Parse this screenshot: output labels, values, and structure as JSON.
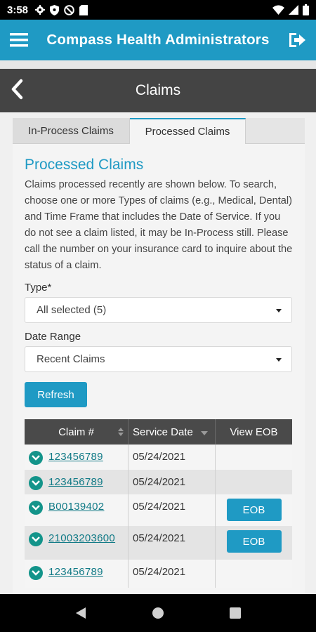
{
  "status_bar": {
    "time": "3:58",
    "icons": [
      "gear-icon",
      "shield-icon",
      "at-sign-icon",
      "sd-card-icon"
    ],
    "right_icons": [
      "wifi-icon",
      "signal-icon",
      "battery-icon"
    ]
  },
  "app_bar": {
    "title": "Compass Health Administrators",
    "menu_icon": "hamburger-icon",
    "logout_icon": "logout-icon",
    "color": "#1f9ac4"
  },
  "page_header": {
    "title": "Claims",
    "back_icon": "chevron-left-icon"
  },
  "tabs": [
    {
      "label": "In-Process Claims",
      "active": false
    },
    {
      "label": "Processed Claims",
      "active": true
    }
  ],
  "section": {
    "title": "Processed Claims",
    "description": "Claims processed recently are shown below. To search, choose one or more Types of claims (e.g., Medical, Dental) and Time Frame that includes the Date of Service. If you do not see a claim listed, it may be In-Process still. Please call the number on your insurance card to inquire about the status of a claim."
  },
  "filters": {
    "type_label": "Type*",
    "type_value": "All selected (5)",
    "date_label": "Date Range",
    "date_value": "Recent Claims"
  },
  "refresh_label": "Refresh",
  "table": {
    "headers": [
      "Claim #",
      "Service Date",
      "View EOB"
    ],
    "rows": [
      {
        "claim": "123456789",
        "date": "05/24/2021",
        "eob": ""
      },
      {
        "claim": "123456789",
        "date": "05/24/2021",
        "eob": ""
      },
      {
        "claim": "B00139402",
        "date": "05/24/2021",
        "eob": "EOB"
      },
      {
        "claim": "21003203600",
        "date": "05/24/2021",
        "eob": "EOB"
      },
      {
        "claim": "123456789",
        "date": "05/24/2021",
        "eob": ""
      }
    ]
  },
  "nav_bar": {
    "icons": [
      "back-triangle-icon",
      "home-circle-icon",
      "recents-square-icon"
    ]
  }
}
